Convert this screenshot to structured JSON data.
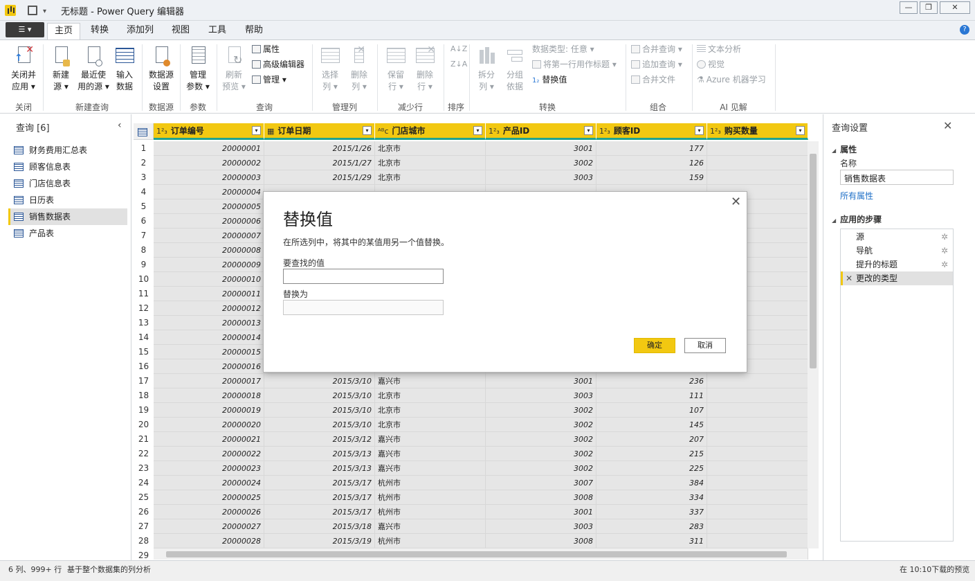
{
  "window": {
    "title": "无标题 - Power Query 编辑器",
    "min": "—",
    "max": "❐",
    "close": "✕"
  },
  "menu": {
    "file": "☰ ▾",
    "tabs": [
      "主页",
      "转换",
      "添加列",
      "视图",
      "工具",
      "帮助"
    ],
    "active_tab": "主页",
    "help": "?"
  },
  "ribbon": {
    "close_apply": [
      "关闭并",
      "应用 ▾"
    ],
    "new_source": [
      "新建",
      "源 ▾"
    ],
    "recent_sources": [
      "最近使",
      "用的源 ▾"
    ],
    "enter_data": [
      "输入",
      "数据"
    ],
    "data_source_settings": [
      "数据源",
      "设置"
    ],
    "manage_params": [
      "管理",
      "参数 ▾"
    ],
    "refresh_preview": [
      "刷新",
      "预览 ▾"
    ],
    "properties": "属性",
    "advanced_editor": "高级编辑器",
    "manage": "管理 ▾",
    "choose_columns": [
      "选择",
      "列 ▾"
    ],
    "remove_columns": [
      "删除",
      "列 ▾"
    ],
    "keep_rows": [
      "保留",
      "行 ▾"
    ],
    "remove_rows": [
      "删除",
      "行 ▾"
    ],
    "split_column": [
      "拆分",
      "列 ▾"
    ],
    "group_by": [
      "分组",
      "依据"
    ],
    "data_type": "数据类型: 任意 ▾",
    "use_first_row": "将第一行用作标题 ▾",
    "replace_values": "替换值",
    "merge_queries": "合并查询 ▾",
    "append_queries": "追加查询 ▾",
    "combine_files": "合并文件",
    "text_analytics": "文本分析",
    "vision": "视觉",
    "azure_ml": "Azure 机器学习",
    "groups": [
      "关闭",
      "新建查询",
      "数据源",
      "参数",
      "查询",
      "管理列",
      "减少行",
      "排序",
      "转换",
      "组合",
      "AI 见解"
    ]
  },
  "queries_panel": {
    "title": "查询 [6]",
    "collapse": "‹",
    "items": [
      "财务费用汇总表",
      "顾客信息表",
      "门店信息表",
      "日历表",
      "销售数据表",
      "产品表"
    ],
    "selected": 4
  },
  "grid": {
    "columns": [
      {
        "type": "1²₃",
        "name": "订单编号"
      },
      {
        "type": "▦",
        "name": "订单日期"
      },
      {
        "type": "ᴬᴮc",
        "name": "门店城市"
      },
      {
        "type": "1²₃",
        "name": "产品ID"
      },
      {
        "type": "1²₃",
        "name": "顾客ID"
      },
      {
        "type": "1²₃",
        "name": "购买数量"
      }
    ],
    "rows": [
      [
        "1",
        "20000001",
        "2015/1/26",
        "北京市",
        "3001",
        "177",
        ""
      ],
      [
        "2",
        "20000002",
        "2015/1/27",
        "北京市",
        "3002",
        "126",
        ""
      ],
      [
        "3",
        "20000003",
        "2015/1/29",
        "北京市",
        "3003",
        "159",
        ""
      ],
      [
        "4",
        "20000004",
        "",
        "",
        "",
        "",
        ""
      ],
      [
        "5",
        "20000005",
        "",
        "",
        "",
        "",
        ""
      ],
      [
        "6",
        "20000006",
        "",
        "",
        "",
        "",
        ""
      ],
      [
        "7",
        "20000007",
        "",
        "",
        "",
        "",
        ""
      ],
      [
        "8",
        "20000008",
        "",
        "",
        "",
        "",
        ""
      ],
      [
        "9",
        "20000009",
        "",
        "",
        "",
        "",
        ""
      ],
      [
        "10",
        "20000010",
        "",
        "",
        "",
        "",
        ""
      ],
      [
        "11",
        "20000011",
        "",
        "",
        "",
        "",
        ""
      ],
      [
        "12",
        "20000012",
        "",
        "",
        "",
        "",
        ""
      ],
      [
        "13",
        "20000013",
        "",
        "",
        "",
        "",
        ""
      ],
      [
        "14",
        "20000014",
        "",
        "",
        "",
        "",
        ""
      ],
      [
        "15",
        "20000015",
        "",
        "",
        "",
        "",
        ""
      ],
      [
        "16",
        "20000016",
        "",
        "",
        "",
        "",
        ""
      ],
      [
        "17",
        "20000017",
        "2015/3/10",
        "嘉兴市",
        "3001",
        "236",
        ""
      ],
      [
        "18",
        "20000018",
        "2015/3/10",
        "北京市",
        "3003",
        "111",
        ""
      ],
      [
        "19",
        "20000019",
        "2015/3/10",
        "北京市",
        "3002",
        "107",
        ""
      ],
      [
        "20",
        "20000020",
        "2015/3/10",
        "北京市",
        "3002",
        "145",
        ""
      ],
      [
        "21",
        "20000021",
        "2015/3/12",
        "嘉兴市",
        "3002",
        "207",
        ""
      ],
      [
        "22",
        "20000022",
        "2015/3/13",
        "嘉兴市",
        "3002",
        "215",
        ""
      ],
      [
        "23",
        "20000023",
        "2015/3/13",
        "嘉兴市",
        "3002",
        "225",
        ""
      ],
      [
        "24",
        "20000024",
        "2015/3/17",
        "杭州市",
        "3007",
        "384",
        ""
      ],
      [
        "25",
        "20000025",
        "2015/3/17",
        "杭州市",
        "3008",
        "334",
        ""
      ],
      [
        "26",
        "20000026",
        "2015/3/17",
        "杭州市",
        "3001",
        "337",
        ""
      ],
      [
        "27",
        "20000027",
        "2015/3/18",
        "嘉兴市",
        "3003",
        "283",
        ""
      ],
      [
        "28",
        "20000028",
        "2015/3/19",
        "杭州市",
        "3008",
        "311",
        ""
      ],
      [
        "29",
        "",
        "",
        "",
        "",
        "",
        ""
      ]
    ]
  },
  "settings_panel": {
    "title": "查询设置",
    "close": "✕",
    "properties_header": "属性",
    "name_label": "名称",
    "name_value": "销售数据表",
    "all_properties": "所有属性",
    "steps_header": "应用的步骤",
    "steps": [
      "源",
      "导航",
      "提升的标题",
      "更改的类型"
    ],
    "selected_step": 3
  },
  "status": {
    "left": "6 列、999+ 行",
    "profile": "基于整个数据集的列分析",
    "right": "在 10:10下载的预览"
  },
  "dialog": {
    "title": "替换值",
    "description": "在所选列中，将其中的某值用另一个值替换。",
    "find_label": "要查找的值",
    "find_value": "",
    "replace_label": "替换为",
    "replace_value": "",
    "ok": "确定",
    "cancel": "取消",
    "close": "✕"
  },
  "colors": {
    "accent": "#f2c811",
    "header_underline": "#21a38f",
    "link": "#1e6fc7"
  }
}
